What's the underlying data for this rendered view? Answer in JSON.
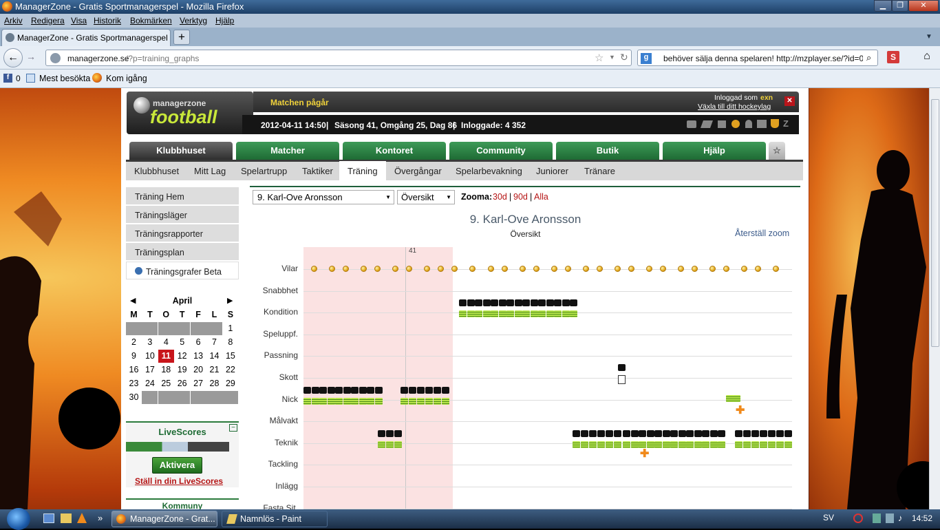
{
  "window": {
    "title": "ManagerZone - Gratis Sportmanagerspel - Mozilla Firefox"
  },
  "menu": [
    "Arkiv",
    "Redigera",
    "Visa",
    "Historik",
    "Bokmärken",
    "Verktyg",
    "Hjälp"
  ],
  "tab": {
    "title": "ManagerZone - Gratis Sportmanagerspel",
    "new_tab": "+"
  },
  "url": {
    "domain": "managerzone.se",
    "path": "/?p=training_graphs"
  },
  "search": {
    "value": "behöver sälja denna spelaren!  http://mzplayer.se/?id=0"
  },
  "bookmarks": {
    "count": "0",
    "most_visited": "Mest besökta",
    "get_started": "Kom igång"
  },
  "header": {
    "logo_top": "managerzone",
    "logo_main": "football",
    "match": "Matchen pågår",
    "logged_in_prefix": "Inloggad som",
    "username": "exn",
    "switch_link": "Växla till ditt hockeylag",
    "close": "✕",
    "date": "2012-04-11 14:50",
    "season": "Säsong 41, Omgång 25, Dag 86",
    "logged_in_count": "Inloggade: 4 352",
    "sep": "|"
  },
  "mainnav": [
    "Klubbhuset",
    "Matcher",
    "Kontoret",
    "Community",
    "Butik",
    "Hjälp"
  ],
  "subnav": [
    "Klubbhuset",
    "Mitt Lag",
    "Spelartrupp",
    "Taktiker",
    "Träning",
    "Övergångar",
    "Spelarbevakning",
    "Juniorer",
    "Tränare"
  ],
  "sidebar": [
    "Träning Hem",
    "Träningsläger",
    "Träningsrapporter",
    "Träningsplan",
    "Träningsgrafer Beta"
  ],
  "calendar": {
    "month": "April",
    "weekdays": [
      "M",
      "T",
      "O",
      "T",
      "F",
      "L",
      "S"
    ],
    "days": [
      "",
      "",
      "",
      "",
      "",
      "",
      "1",
      "2",
      "3",
      "4",
      "5",
      "6",
      "7",
      "8",
      "9",
      "10",
      "11",
      "12",
      "13",
      "14",
      "15",
      "16",
      "17",
      "18",
      "19",
      "20",
      "21",
      "22",
      "23",
      "24",
      "25",
      "26",
      "27",
      "28",
      "29",
      "30",
      "",
      "",
      "",
      "",
      "",
      ""
    ],
    "today": "11"
  },
  "livescores": {
    "title": "LiveScores",
    "toggle": "−",
    "activate": "Aktivera",
    "settings": "Ställ in din LiveScores",
    "next_box": "Kommuny"
  },
  "controls": {
    "player_select": "9. Karl-Ove Aronsson",
    "view_select": "Översikt",
    "zoom_label": "Zooma:",
    "zoom_30": "30d",
    "zoom_90": "90d",
    "zoom_all": "Alla",
    "zoom_sep": "|"
  },
  "chart": {
    "title": "9. Karl-Ove Aronsson",
    "subtitle": "Översikt",
    "reset": "Återställ zoom",
    "marker": "41",
    "rows": [
      "Vilar",
      "Snabbhet",
      "Kondition",
      "Speluppf.",
      "Passning",
      "Skott",
      "Nick",
      "Målvakt",
      "Teknik",
      "Tackling",
      "Inlägg",
      "Fasta Sit."
    ]
  },
  "taskbar": {
    "firefox": "ManagerZone - Grat...",
    "paint": "Namnlös - Paint",
    "lang": "SV",
    "time": "14:52",
    "more": "»"
  },
  "colors": {
    "green": "#1e6b34",
    "red_link": "#b51414",
    "today": "#c8151b",
    "camp": "#fbe2e2"
  }
}
